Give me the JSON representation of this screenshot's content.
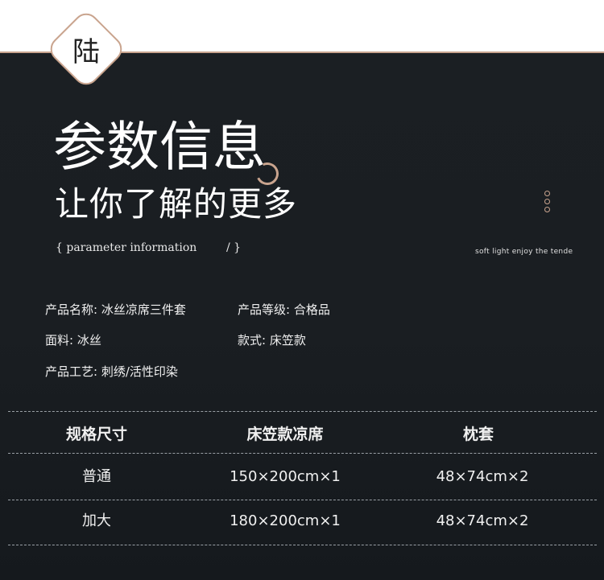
{
  "badge": "陆",
  "heading": {
    "line1": "参数信息",
    "line2": "让你了解的更多",
    "sub_open": "{ parameter information",
    "sub_close": "/ }",
    "slogan": "soft light enjoy the tende"
  },
  "info": [
    {
      "key": "产品名称:",
      "value": " 冰丝凉席三件套"
    },
    {
      "key": "产品等级:",
      "value": " 合格品"
    },
    {
      "key": "面料:",
      "value": " 冰丝"
    },
    {
      "key": "款式:",
      "value": " 床笠款"
    },
    {
      "key": "产品工艺:",
      "value": " 刺绣/活性印染"
    }
  ],
  "table": {
    "headers": [
      "规格尺寸",
      "床笠款凉席",
      "枕套"
    ],
    "rows": [
      [
        "普通",
        "150×200cm×1",
        "48×74cm×2"
      ],
      [
        "加大",
        "180×200cm×1",
        "48×74cm×2"
      ]
    ]
  },
  "colors": {
    "accent": "#c9a48e",
    "panel": "#1b1f23"
  }
}
